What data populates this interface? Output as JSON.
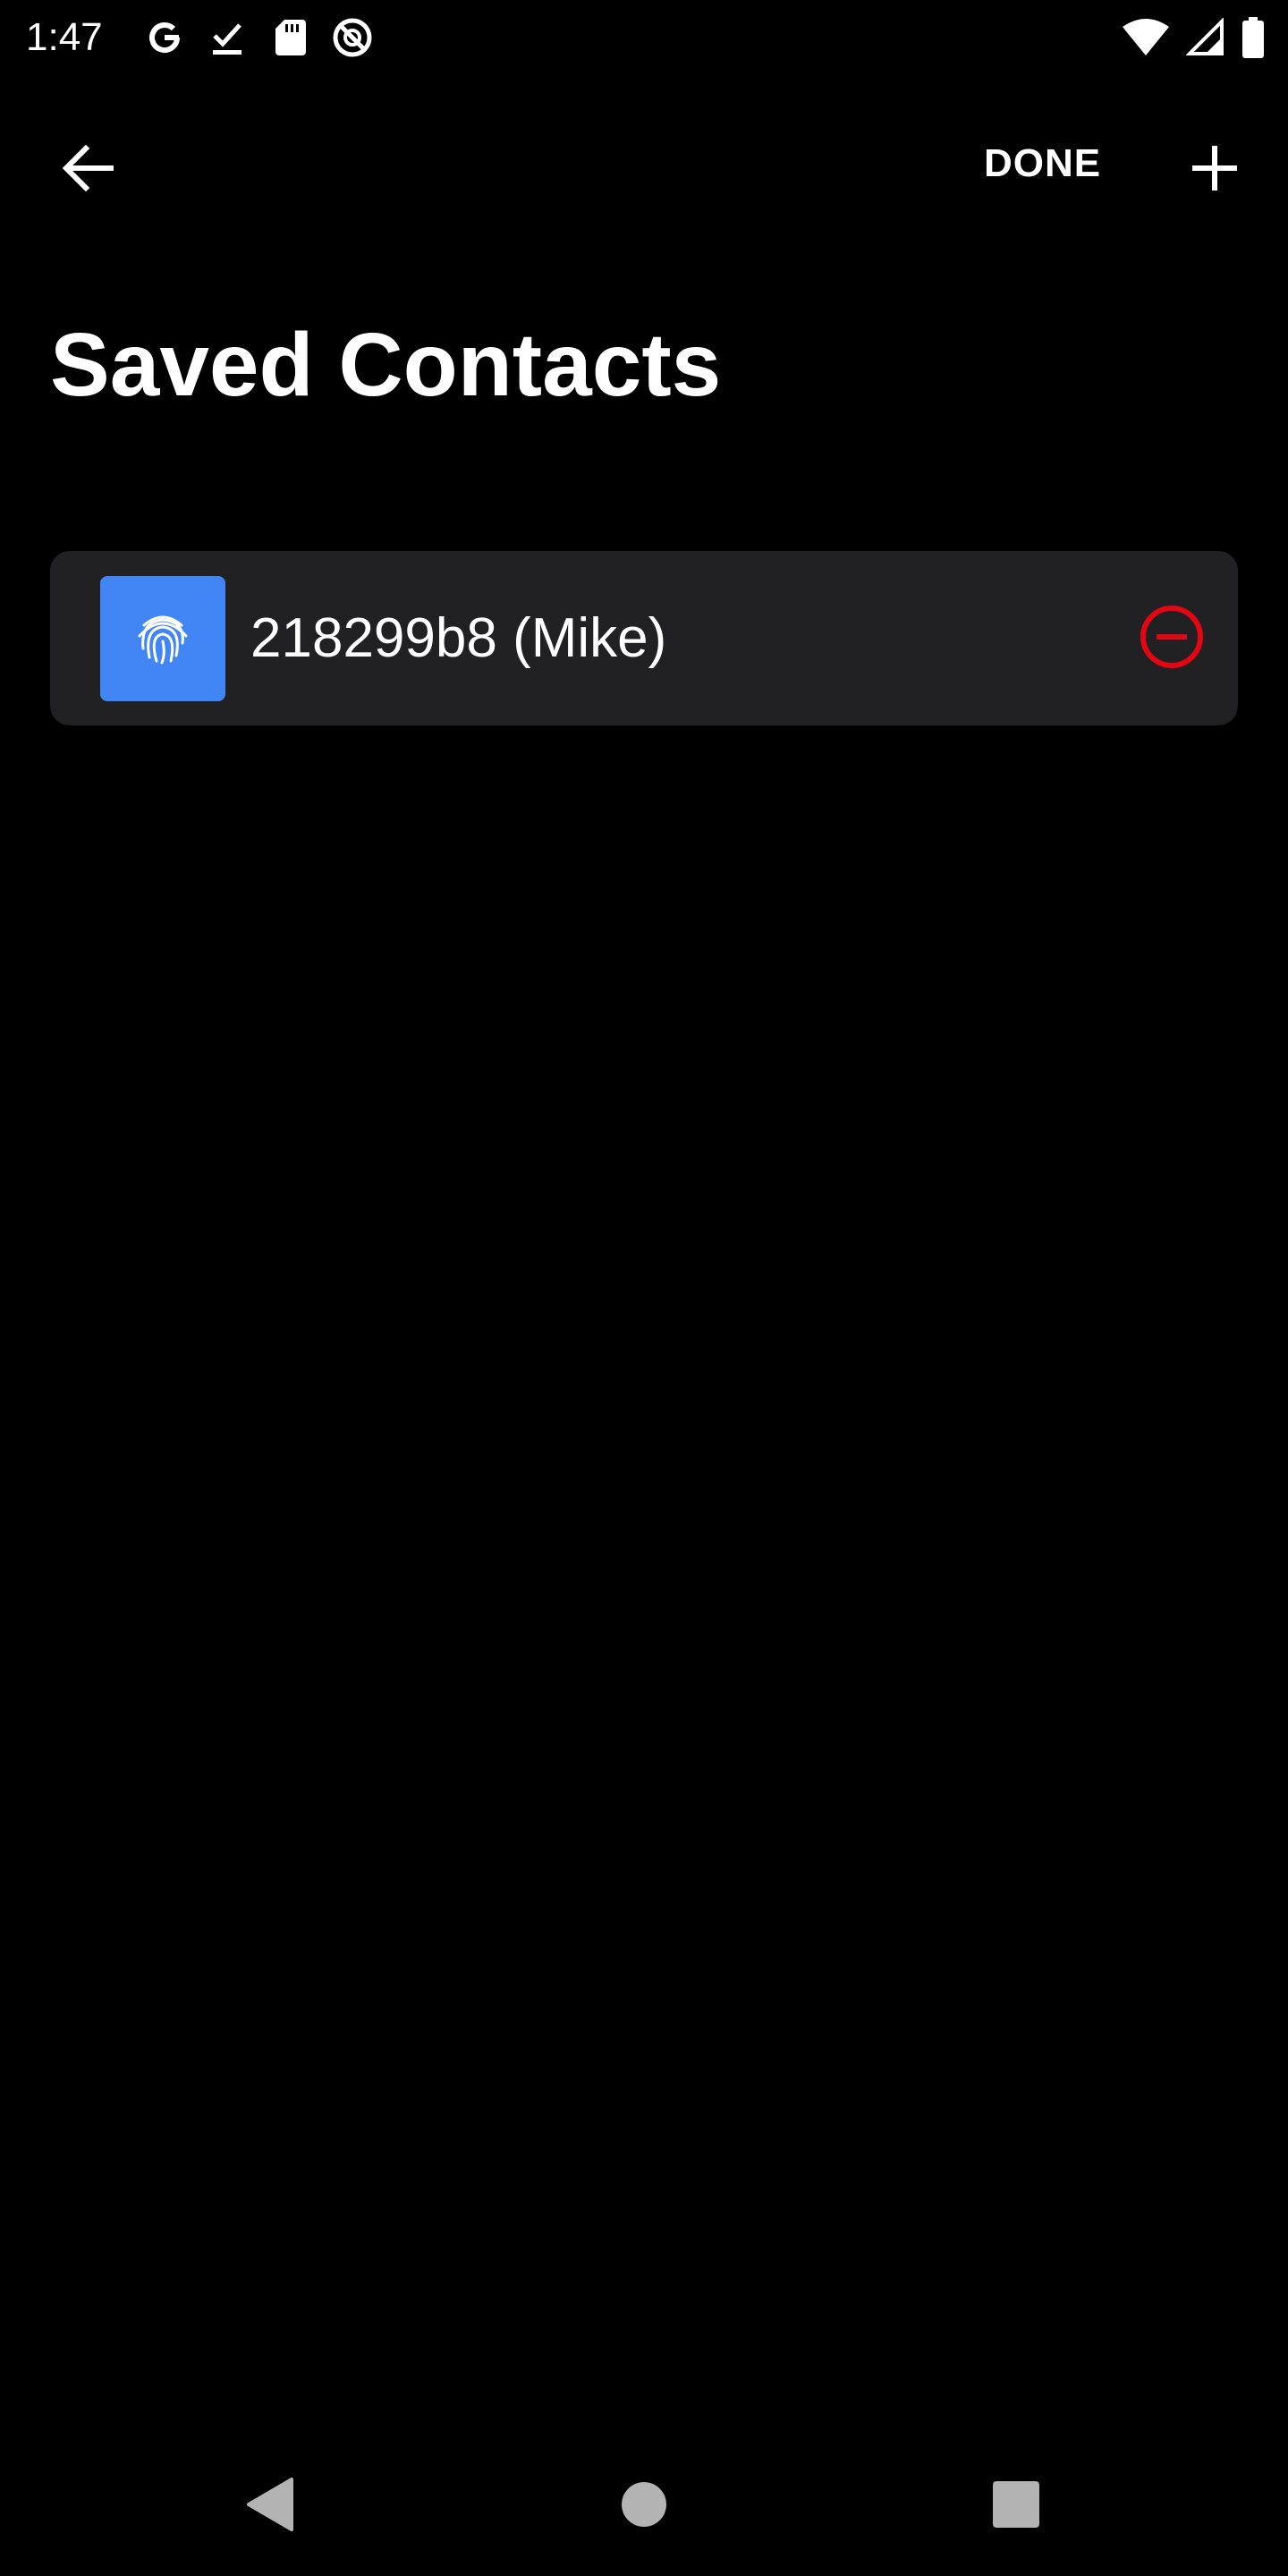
{
  "status_bar": {
    "time": "1:47",
    "left_icons": [
      "google-icon",
      "download-done-icon",
      "sd-card-icon",
      "no-disturb-icon"
    ],
    "right_icons": [
      "wifi-icon",
      "signal-icon",
      "battery-icon"
    ]
  },
  "app_bar": {
    "back_icon": "arrow-back-icon",
    "done_label": "DONE",
    "add_icon": "plus-icon"
  },
  "page": {
    "title": "Saved Contacts"
  },
  "contacts": [
    {
      "name": "218299b8 (Mike)",
      "avatar_icon": "fingerprint-icon",
      "avatar_color": "#4285f4",
      "remove_icon": "remove-circle-icon",
      "remove_color": "#e30613"
    }
  ],
  "colors": {
    "background": "#000000",
    "card": "#212123",
    "text": "#ffffff",
    "nav_icons": "#b3b3b3"
  },
  "nav_bar": {
    "icons": [
      "nav-back-icon",
      "nav-home-icon",
      "nav-recents-icon"
    ]
  }
}
